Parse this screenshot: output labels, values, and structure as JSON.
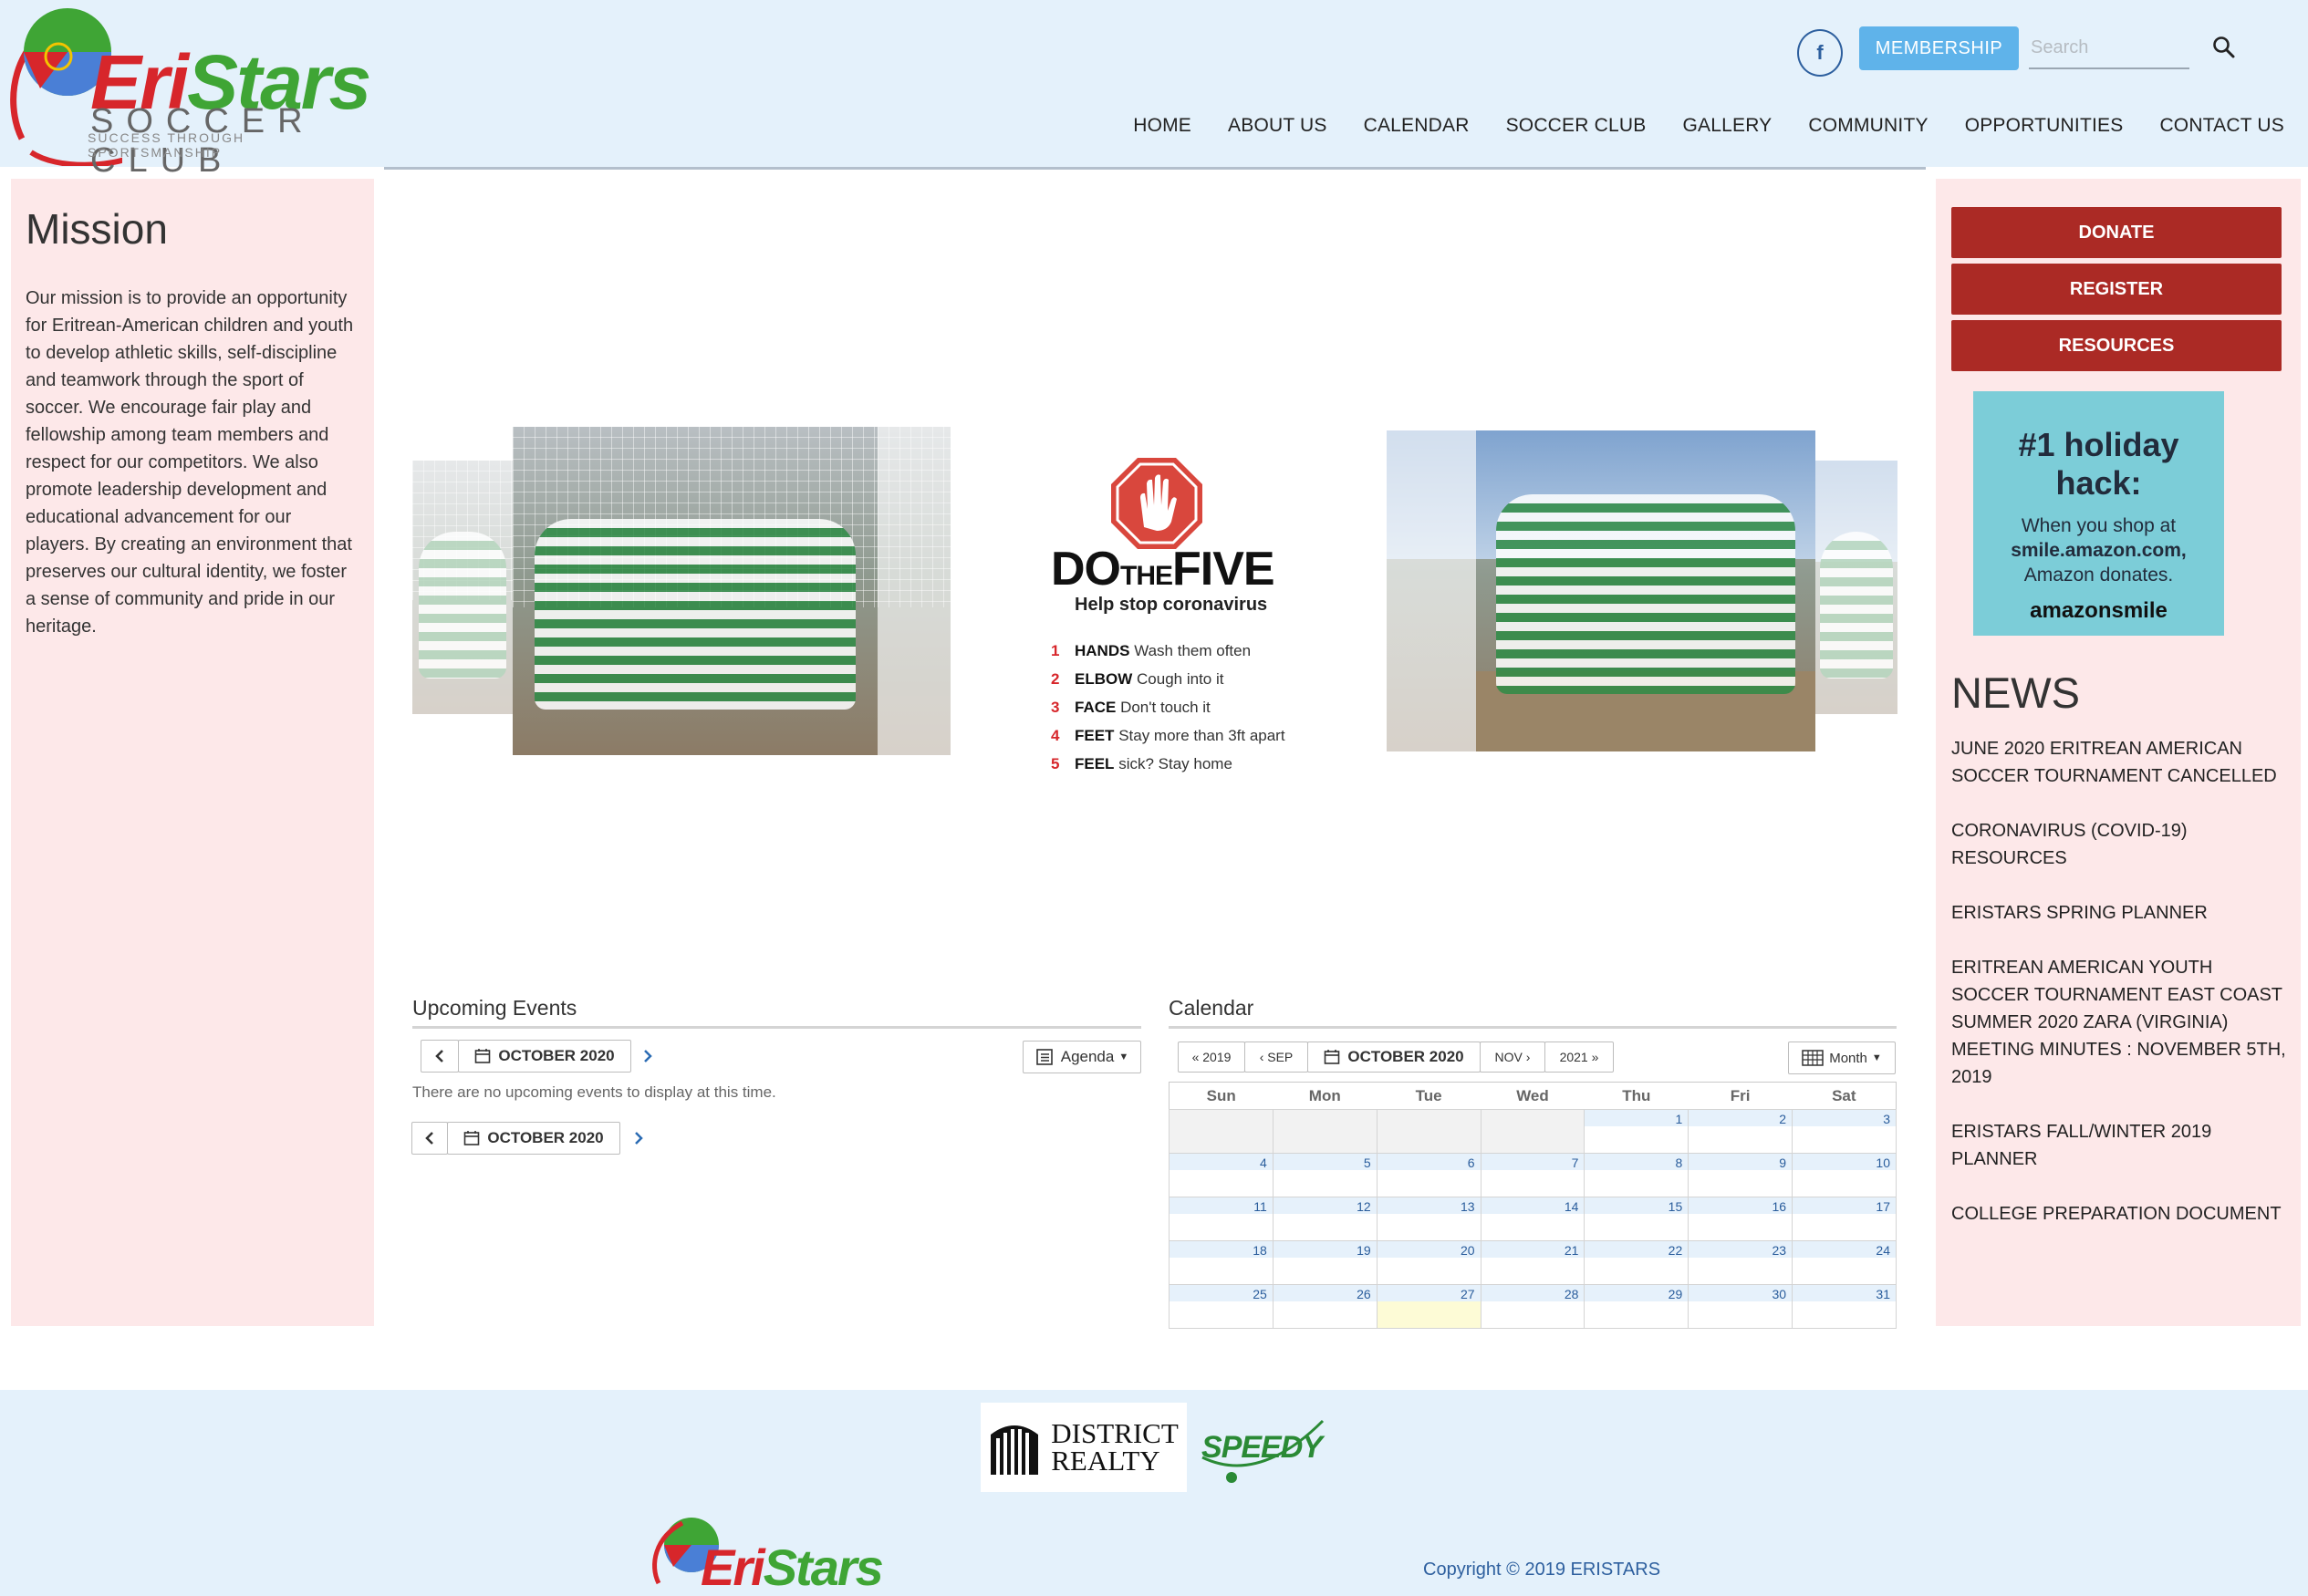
{
  "header": {
    "logo_eri": "Eri",
    "logo_stars": "Stars",
    "logo_sub": "SOCCER CLUB",
    "logo_tagline": "SUCCESS THROUGH SPORTSMANSHIP",
    "facebook_icon": "f",
    "membership_label": "MEMBERSHIP",
    "search_placeholder": "Search"
  },
  "nav": {
    "items": [
      "HOME",
      "ABOUT US",
      "CALENDAR",
      "SOCCER CLUB",
      "GALLERY",
      "COMMUNITY",
      "OPPORTUNITIES",
      "CONTACT US"
    ]
  },
  "mission": {
    "title": "Mission",
    "text": "Our mission is to provide an opportunity for Eritrean-American children and youth to develop athletic skills, self-discipline and teamwork through the sport of soccer. We encourage fair play and fellowship among team members and respect for our competitors. We also promote leadership development and educational advancement for our players. By creating an environment that preserves our cultural identity, we foster a sense of community and pride in our heritage."
  },
  "sidebar": {
    "donate": "DONATE",
    "register": "REGISTER",
    "resources": "RESOURCES",
    "ad_heading": "#1 holiday hack:",
    "ad_line1": "When you shop at",
    "ad_line2": "smile.amazon.com,",
    "ad_line3": "Amazon donates.",
    "ad_brand": "amazonsmile",
    "news_title": "NEWS",
    "news": [
      "JUNE 2020 ERITREAN AMERICAN SOCCER TOURNAMENT CANCELLED",
      "CORONAVIRUS (COVID-19) RESOURCES",
      "ERISTARS SPRING PLANNER",
      "ERITREAN AMERICAN YOUTH SOCCER TOURNAMENT EAST COAST SUMMER 2020 ZARA (VIRGINIA) MEETING MINUTES : NOVEMBER 5TH, 2019",
      "ERISTARS FALL/WINTER 2019 PLANNER",
      "COLLEGE PREPARATION DOCUMENT"
    ]
  },
  "slider": {
    "d5_do": "DO",
    "d5_the": "THE",
    "d5_five": "FIVE",
    "d5_sub": "Help stop coronavirus",
    "d5_items": [
      {
        "n": "1",
        "k": "HANDS",
        "v": "Wash them often"
      },
      {
        "n": "2",
        "k": "ELBOW",
        "v": "Cough into it"
      },
      {
        "n": "3",
        "k": "FACE",
        "v": "Don't touch it"
      },
      {
        "n": "4",
        "k": "FEET",
        "v": "Stay more than 3ft apart"
      },
      {
        "n": "5",
        "k": "FEEL",
        "v": "sick? Stay home"
      }
    ]
  },
  "upcoming": {
    "title": "Upcoming Events",
    "month": "OCTOBER 2020",
    "view": "Agenda",
    "empty": "There are no upcoming events to display at this time."
  },
  "calendar": {
    "title": "Calendar",
    "prev_year": "« 2019",
    "prev_month": "‹ SEP",
    "month": "OCTOBER 2020",
    "next_month": "NOV ›",
    "next_year": "2021 »",
    "view": "Month",
    "weekdays": [
      "Sun",
      "Mon",
      "Tue",
      "Wed",
      "Thu",
      "Fri",
      "Sat"
    ],
    "weeks": [
      [
        "",
        "",
        "",
        "",
        "1",
        "2",
        "3"
      ],
      [
        "4",
        "5",
        "6",
        "7",
        "8",
        "9",
        "10"
      ],
      [
        "11",
        "12",
        "13",
        "14",
        "15",
        "16",
        "17"
      ],
      [
        "18",
        "19",
        "20",
        "21",
        "22",
        "23",
        "24"
      ],
      [
        "25",
        "26",
        "27",
        "28",
        "29",
        "30",
        "31"
      ]
    ],
    "today": "27"
  },
  "footer": {
    "sponsor1_line1": "DISTRICT",
    "sponsor1_line2": "REALTY",
    "sponsor2": "SPEEDY",
    "logo_eri": "Eri",
    "logo_stars": "Stars",
    "copyright": "Copyright © 2019 ERISTARS"
  },
  "colors": {
    "header_bg": "#e4f1fb",
    "panel_bg": "#fde8e9",
    "button_red": "#ab2a25",
    "membership_blue": "#5fb3ea",
    "link_blue": "#2a5d9c"
  }
}
